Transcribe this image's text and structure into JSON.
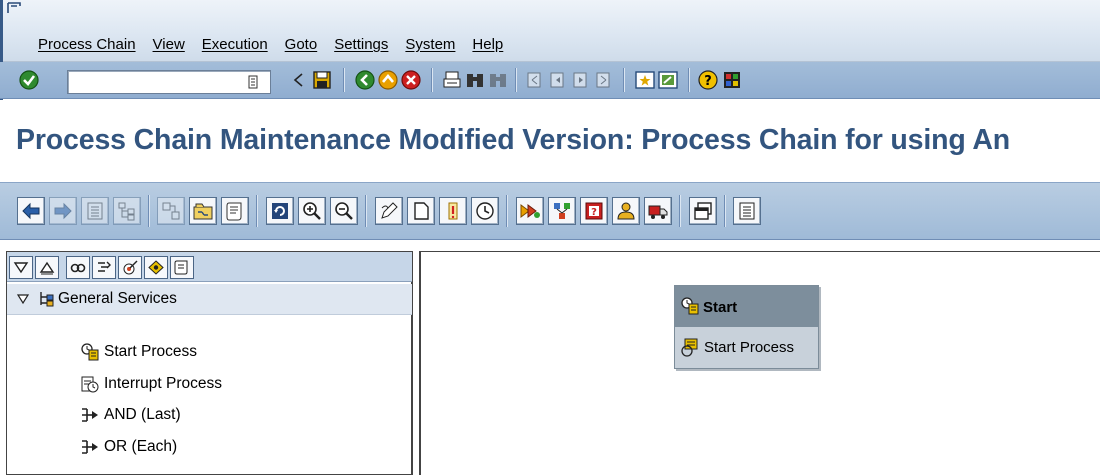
{
  "menu": {
    "items": [
      "Process Chain",
      "View",
      "Execution",
      "Goto",
      "Settings",
      "System",
      "Help"
    ]
  },
  "std_toolbar": {
    "command_field_value": "",
    "icons": [
      "enter-check-icon",
      "command-dropdown-icon",
      "back-arrow-small-icon",
      "save-icon",
      "back-icon",
      "exit-icon",
      "cancel-icon",
      "print-icon",
      "find-icon",
      "find-next-icon",
      "first-page-icon",
      "previous-page-icon",
      "next-page-icon",
      "last-page-icon",
      "new-session-icon",
      "shortcut-icon",
      "help-icon",
      "layout-icon"
    ]
  },
  "page": {
    "title": "Process Chain Maintenance Modified Version: Process Chain for using An"
  },
  "app_toolbar": {
    "icons": [
      "back-arrow-icon",
      "forward-arrow-icon",
      "list-icon",
      "tree-icon",
      "hierarchy-icon",
      "chain-folder-icon",
      "scroll-icon",
      "refresh-icon",
      "zoom-in-icon",
      "zoom-out-icon",
      "edit-pencil-icon",
      "document-icon",
      "info-icon",
      "clock-icon",
      "activate-icon",
      "transport-icon",
      "error-log-icon",
      "user-icon",
      "truck-icon",
      "window-icon",
      "settings-list-icon"
    ]
  },
  "tree": {
    "tools": [
      "expand-icon",
      "collapse-icon",
      "link-icon",
      "filter-icon",
      "target-icon",
      "diamond-icon",
      "scroll-icon"
    ],
    "group_label": "General Services",
    "items": [
      "Start Process",
      "Interrupt Process",
      "AND (Last)",
      "OR (Each)"
    ]
  },
  "canvas": {
    "node": {
      "title": "Start",
      "subtitle": "Start Process"
    }
  },
  "colors": {
    "title_text": "#33557f",
    "toolbar_blue": "#9fbad7",
    "node_header": "#7d8e9c"
  }
}
